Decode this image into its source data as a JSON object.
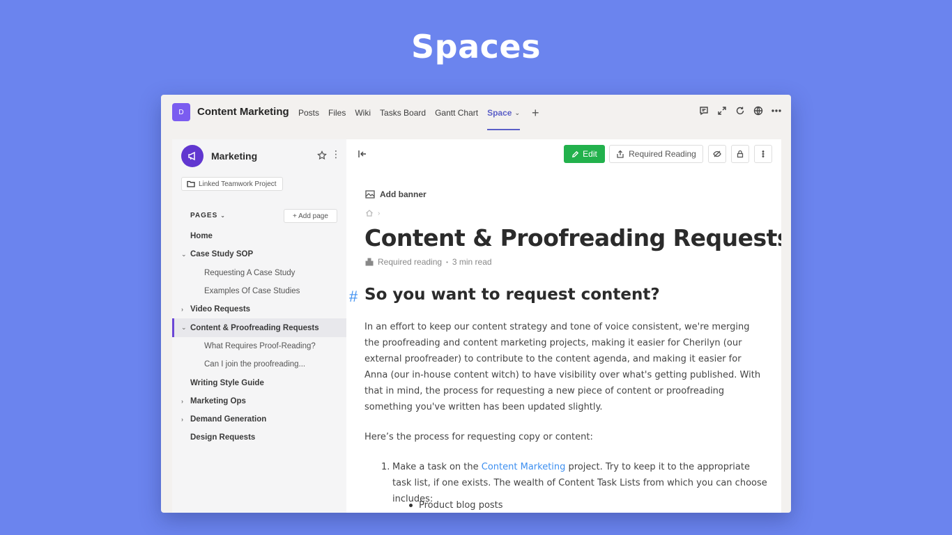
{
  "hero": {
    "title": "Spaces"
  },
  "app": {
    "team_initial": "D",
    "team_name": "Content Marketing",
    "tabs": [
      {
        "label": "Posts"
      },
      {
        "label": "Files"
      },
      {
        "label": "Wiki"
      },
      {
        "label": "Tasks Board"
      },
      {
        "label": "Gantt Chart"
      },
      {
        "label": "Space",
        "active": true
      }
    ],
    "top_icons": [
      "chat-icon",
      "expand-icon",
      "refresh-icon",
      "globe-icon",
      "more-icon"
    ]
  },
  "sidebar": {
    "space_name": "Marketing",
    "linked_project": "Linked Teamwork Project",
    "pages_label": "PAGES",
    "add_page_label": "+ Add page",
    "items": [
      {
        "label": "Home",
        "level": 0,
        "caret": ""
      },
      {
        "label": "Case Study SOP",
        "level": 0,
        "caret": "expanded"
      },
      {
        "label": "Requesting A Case Study",
        "level": 1,
        "caret": ""
      },
      {
        "label": "Examples Of Case Studies",
        "level": 1,
        "caret": ""
      },
      {
        "label": "Video Requests",
        "level": 0,
        "caret": "collapsed"
      },
      {
        "label": "Content & Proofreading Requests",
        "level": 0,
        "caret": "expanded",
        "active": true
      },
      {
        "label": "What Requires Proof-Reading?",
        "level": 1,
        "caret": ""
      },
      {
        "label": "Can I join the proofreading...",
        "level": 1,
        "caret": ""
      },
      {
        "label": "Writing Style Guide",
        "level": 0,
        "caret": ""
      },
      {
        "label": "Marketing Ops",
        "level": 0,
        "caret": "collapsed"
      },
      {
        "label": "Demand Generation",
        "level": 0,
        "caret": "collapsed"
      },
      {
        "label": "Design Requests",
        "level": 0,
        "caret": ""
      }
    ]
  },
  "main": {
    "edit_label": "Edit",
    "required_reading_label": "Required Reading",
    "add_banner_label": "Add banner",
    "page_title": "Content & Proofreading Requests",
    "meta_required": "Required reading",
    "meta_read_time": "3 min read",
    "heading": "So you want to request content?",
    "paragraph1": "In an effort to keep our content strategy and tone of voice consistent, we're merging the proofreading and content marketing projects, making it easier for Cherilyn (our external proofreader) to contribute to the content agenda, and making it easier for Anna (our in-house content witch) to have visibility over what's getting published. With that in mind, the process for requesting a new piece of content or proofreading something you've written has been updated slightly.",
    "paragraph2": "Here’s the process for requesting copy or content:",
    "list_item_num": "1.",
    "list_item_pre": "Make a task on the ",
    "list_item_link": "Content Marketing",
    "list_item_post": " project. Try to keep it to the appropriate task list, if one exists. The wealth of Content Task Lists from which you can choose includes:",
    "bullet1": "Product blog posts"
  }
}
